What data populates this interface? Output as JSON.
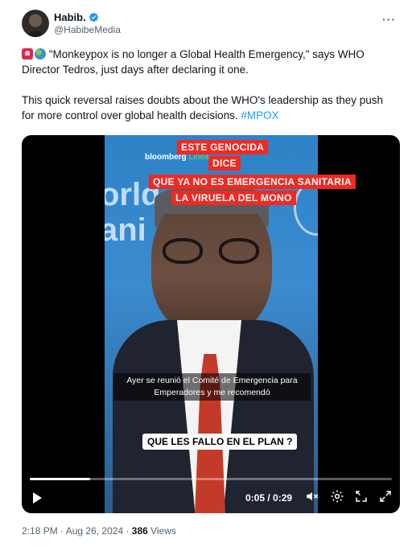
{
  "author": {
    "display_name": "Habib.",
    "handle": "@HabibeMedia",
    "verified": true,
    "avatar_icon": "avatar-photo"
  },
  "more_label": "···",
  "tweet": {
    "line1_emojis": [
      "siren-emoji",
      "globe-emoji"
    ],
    "paragraph1": " \"Monkeypox is no longer a Global Health Emergency,\" says WHO Director Tedros, just days after declaring it one.",
    "paragraph2": "This quick reversal raises doubts about the WHO's leadership as they push for more control over global health decisions. ",
    "hashtag": "#MPOX"
  },
  "video": {
    "captions": [
      "ESTE GENOCIDA",
      "DICE",
      "QUE YA NO ES EMERGENCIA SANITARIA",
      "LA VIRUELA DEL MONO"
    ],
    "watermark": "bloomberg",
    "watermark_suffix": "Línea",
    "background_text": "orld\nani",
    "subtitle": "Ayer se reunió el Comité de Emergencia para Emperadores y me recomendó",
    "answer_caption": "QUE LES FALLO EN EL PLAN ?",
    "progress_fraction": 0.167,
    "time_display": "0:05 / 0:29",
    "accent_caption_color": "#ee2a22"
  },
  "meta": {
    "time": "2:18 PM",
    "date": "Aug 26, 2024",
    "views_count": "386",
    "views_label": "Views",
    "separator": " · "
  }
}
